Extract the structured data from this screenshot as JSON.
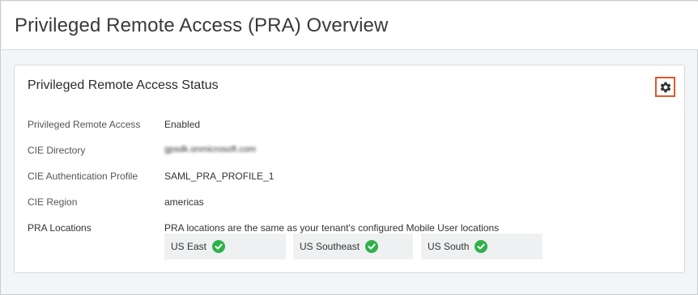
{
  "page": {
    "title": "Privileged Remote Access (PRA) Overview"
  },
  "card": {
    "title": "Privileged Remote Access Status",
    "settings_icon": "gear-icon",
    "rows": [
      {
        "label": "Privileged Remote Access",
        "value": "Enabled"
      },
      {
        "label": "CIE Directory",
        "value": "gpsdk.onmicrosoft.com"
      },
      {
        "label": "CIE Authentication Profile",
        "value": "SAML_PRA_PROFILE_1"
      },
      {
        "label": "CIE Region",
        "value": "americas"
      },
      {
        "label": "PRA Locations",
        "value": "PRA locations are the same as your tenant's configured Mobile User locations"
      }
    ],
    "locations": [
      {
        "name": "US East",
        "status_icon": "check-circle-icon"
      },
      {
        "name": "US Southeast",
        "status_icon": "check-circle-icon"
      },
      {
        "name": "US South",
        "status_icon": "check-circle-icon"
      }
    ]
  },
  "colors": {
    "accent_border": "#e0592a",
    "check_green": "#2eb14a"
  }
}
